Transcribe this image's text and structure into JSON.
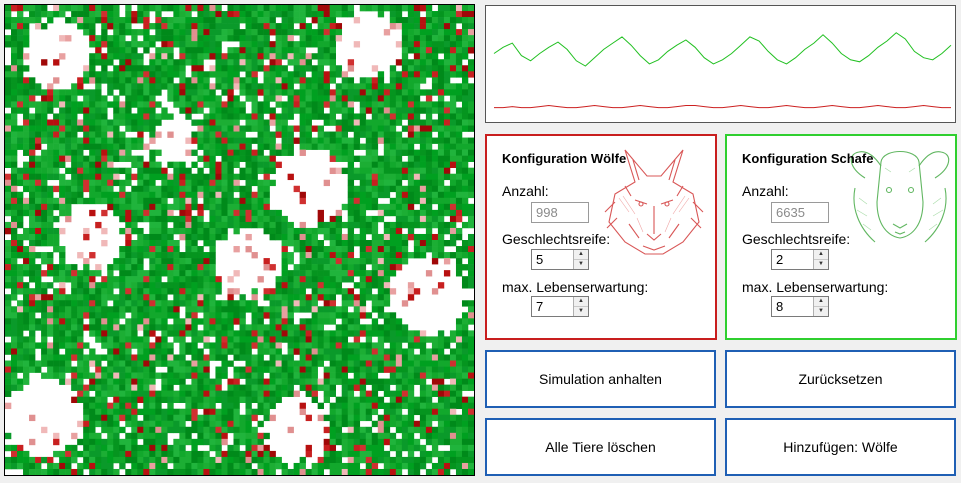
{
  "config_wolves": {
    "title": "Konfiguration Wölfe",
    "count_label": "Anzahl:",
    "count_value": "998",
    "maturity_label": "Geschlechtsreife:",
    "maturity_value": "5",
    "lifespan_label": "max. Lebenserwartung:",
    "lifespan_value": "7",
    "color": "#c81e1e",
    "image_icon": "wolf-head-icon"
  },
  "config_sheep": {
    "title": "Konfiguration Schafe",
    "count_label": "Anzahl:",
    "count_value": "6635",
    "maturity_label": "Geschlechtsreife:",
    "maturity_value": "2",
    "lifespan_label": "max. Lebenserwartung:",
    "lifespan_value": "8",
    "color": "#2fcf2f",
    "image_icon": "sheep-head-icon"
  },
  "buttons": {
    "pause": "Simulation anhalten",
    "reset": "Zurücksetzen",
    "delete_all": "Alle Tiere löschen",
    "add": "Hinzufügen: Wölfe"
  },
  "colors": {
    "sheep_cell": "#0aa62a",
    "wolf_cell": "#c01818",
    "button_border": "#1f5fb4",
    "graph_sheep_line": "#22c022",
    "graph_wolf_line": "#cc2020"
  },
  "chart_data": {
    "type": "line",
    "series": [
      {
        "values": [
          62,
          68,
          72,
          60,
          55,
          62,
          68,
          73,
          66,
          55,
          50,
          58,
          66,
          72,
          78,
          70,
          60,
          52,
          56,
          64,
          70,
          75,
          68,
          58,
          52,
          56,
          62,
          70,
          78,
          74,
          64,
          56,
          52,
          58,
          66,
          72,
          80,
          72,
          62,
          56,
          54,
          60,
          68,
          74,
          82,
          76,
          64,
          58,
          56,
          62,
          70
        ]
      },
      {
        "values": [
          10,
          10,
          11,
          10,
          10,
          11,
          12,
          11,
          10,
          10,
          11,
          12,
          11,
          10,
          10,
          11,
          12,
          11,
          10,
          10,
          11,
          12,
          12,
          11,
          10,
          10,
          11,
          12,
          11,
          10,
          10,
          11,
          12,
          11,
          10,
          10,
          11,
          12,
          11,
          10,
          10,
          11,
          12,
          11,
          10,
          10,
          11,
          12,
          11,
          10,
          10
        ]
      }
    ]
  }
}
